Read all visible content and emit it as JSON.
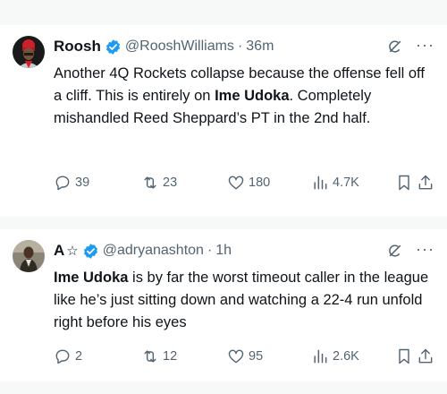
{
  "tweets": [
    {
      "author_name": "Roosh",
      "handle": "@RooshWilliams",
      "separator": "·",
      "time": "36m",
      "body_before": "Another 4Q Rockets collapse because the offense fell off a cliff. This is entirely on ",
      "body_bold": "Ime Udoka",
      "body_after": ". Completely mishandled Reed Sheppard’s PT in the 2nd half.",
      "replies": "39",
      "reposts": "23",
      "likes": "180",
      "views": "4.7K",
      "icons": [
        "grok-icon",
        "more-icon",
        "reply-icon",
        "repost-icon",
        "like-icon",
        "views-icon",
        "bookmark-icon",
        "share-icon"
      ]
    },
    {
      "author_name": "A",
      "name_glyph": "☆",
      "handle": "@adryanashton",
      "separator": "·",
      "time": "1h",
      "body_bold": "Ime Udoka",
      "body_after": " is by far the worst timeout caller in the league like he’s just sitting down and watching a 22-4 run unfold right before his eyes",
      "replies": "2",
      "reposts": "12",
      "likes": "95",
      "views": "2.6K"
    }
  ],
  "colors": {
    "verified": "#1d9bf0",
    "text": "#0f1419",
    "secondary": "#536471",
    "divider": "#eff3f4",
    "background": "#f7f9f9"
  }
}
